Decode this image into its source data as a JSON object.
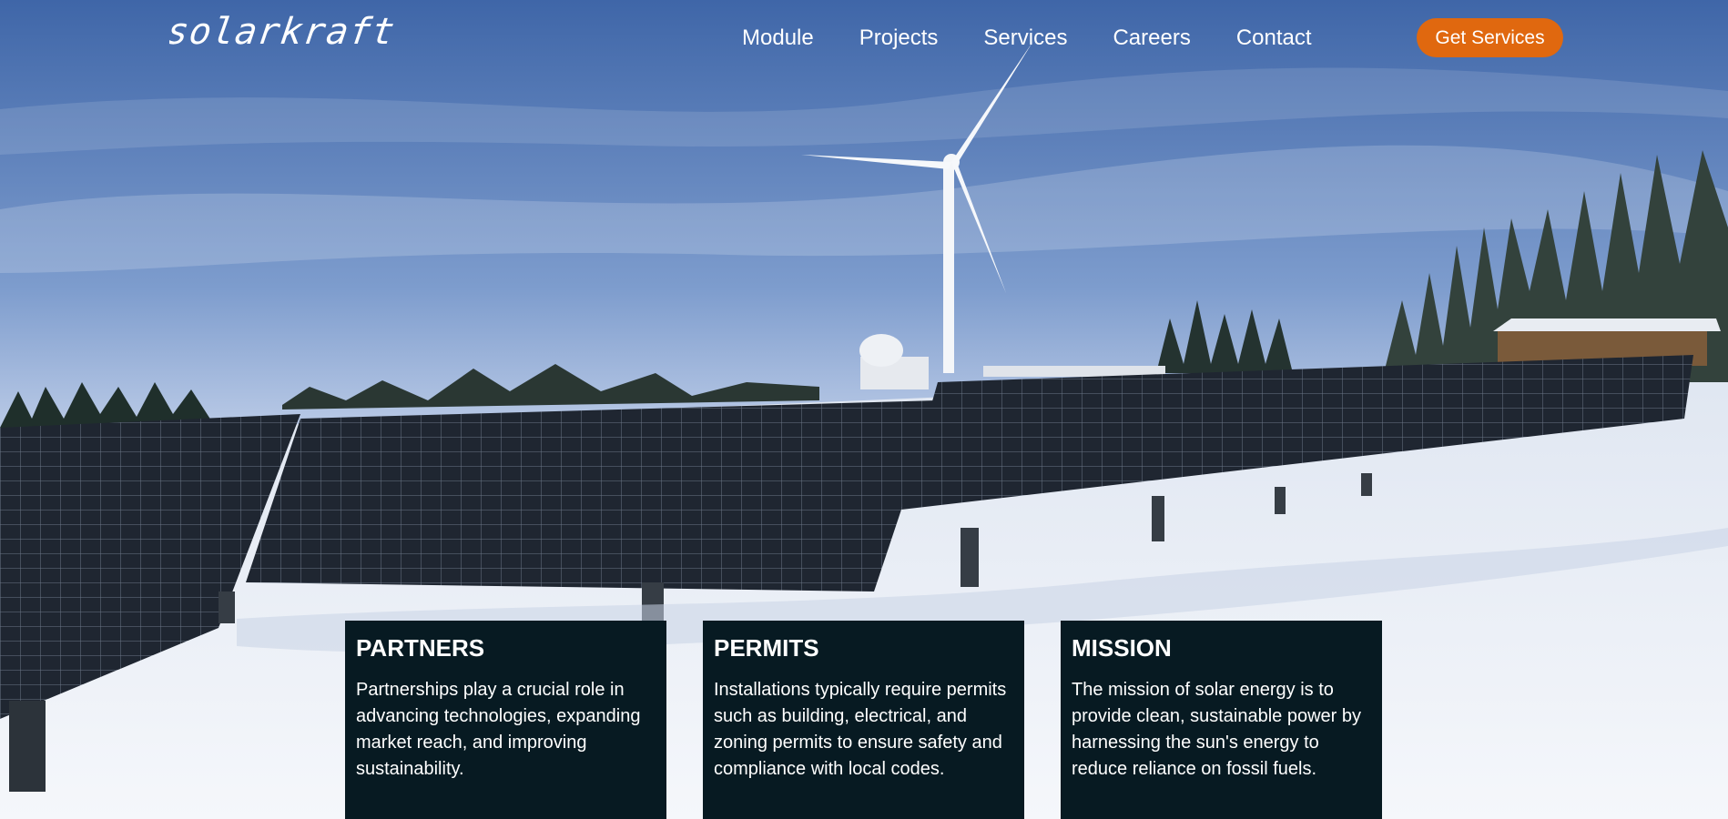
{
  "header": {
    "logo_text": "solarkraft",
    "nav": [
      "Module",
      "Projects",
      "Services",
      "Careers",
      "Contact"
    ],
    "cta_label": "Get Services"
  },
  "cards": [
    {
      "title": "PARTNERS",
      "text": "Partnerships play a crucial role in advancing technologies, expanding market reach, and improving sustainability."
    },
    {
      "title": "PERMITS",
      "text": "Installations typically require permits such as building, electrical, and zoning permits to ensure safety and compliance with local codes."
    },
    {
      "title": "MISSION",
      "text": "The mission of solar energy is to provide clean, sustainable power by harnessing the sun's energy to reduce reliance on fossil fuels."
    }
  ],
  "colors": {
    "accent": "#e0680f",
    "card_bg": "#071a22",
    "sky": "#6d8ec4",
    "snow": "#f2f4f8",
    "panel": "#1e2530"
  }
}
